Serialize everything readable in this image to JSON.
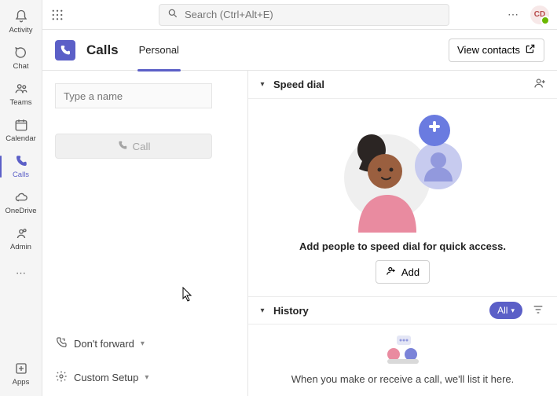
{
  "rail": {
    "items": [
      {
        "label": "Activity"
      },
      {
        "label": "Chat"
      },
      {
        "label": "Teams"
      },
      {
        "label": "Calendar"
      },
      {
        "label": "Calls"
      },
      {
        "label": "OneDrive"
      },
      {
        "label": "Admin"
      }
    ],
    "apps_label": "Apps"
  },
  "search": {
    "placeholder": "Search (Ctrl+Alt+E)"
  },
  "user": {
    "initials": "CD"
  },
  "header": {
    "title": "Calls",
    "tab_personal": "Personal",
    "view_contacts": "View contacts"
  },
  "dial": {
    "name_placeholder": "Type a name",
    "call_label": "Call",
    "forward_label": "Don't forward",
    "custom_setup_label": "Custom Setup"
  },
  "speed": {
    "title": "Speed dial",
    "prompt": "Add people to speed dial for quick access.",
    "add_label": "Add"
  },
  "history": {
    "title": "History",
    "filter_all": "All",
    "empty": "When you make or receive a call, we'll list it here."
  }
}
